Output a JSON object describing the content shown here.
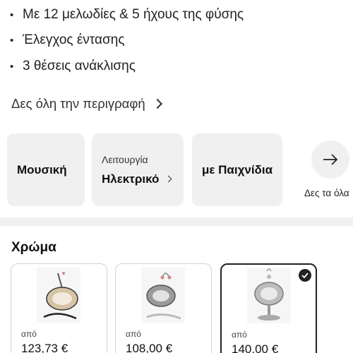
{
  "features": [
    {
      "bullet": "•",
      "text": "Με 12 μελωδίες & 5 ήχους της φύσης"
    },
    {
      "bullet": "•",
      "text": "Έλεγχος έντασης"
    },
    {
      "bullet": "•",
      "text": "3 θέσεις ανάκλισης"
    }
  ],
  "description_link": "Δες όλη την περιγραφή",
  "filters": {
    "music": "Μουσική",
    "function_label": "Λειτουργία",
    "function_value": "Ηλεκτρικό",
    "toys": "με Παιχνίδια",
    "see_all": "Δες τα όλα"
  },
  "color_section": {
    "title": "Χρώμα",
    "options": [
      {
        "from": "από",
        "price": "123,73 €",
        "selected": false
      },
      {
        "from": "από",
        "price": "108,00 €",
        "selected": false
      },
      {
        "from": "από",
        "price": "140,00 €",
        "selected": true
      }
    ]
  },
  "colors": {
    "chip_bg": "#f0f0f0",
    "divider": "#f0f0f0",
    "selected_border": "#222222"
  }
}
